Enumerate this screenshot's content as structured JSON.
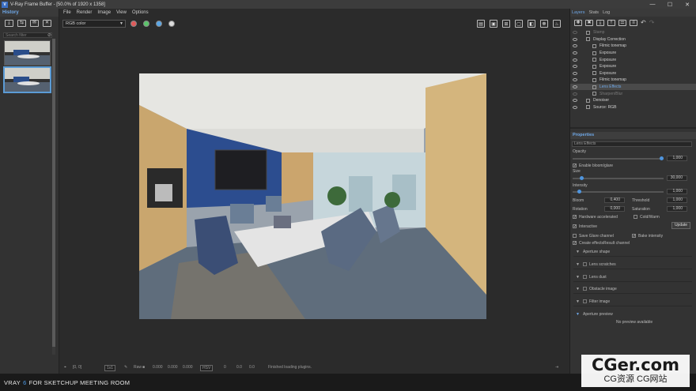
{
  "window": {
    "title": "V-Ray Frame Buffer - [50.0% of 1920 x 1358]",
    "app_icon": "V"
  },
  "history": {
    "title": "History",
    "search_placeholder": "Search filter",
    "thumbnails": [
      {
        "selected": false
      },
      {
        "selected": true
      }
    ]
  },
  "menu": [
    "File",
    "Render",
    "Image",
    "View",
    "Options"
  ],
  "toolbar": {
    "channel": "RGB color",
    "dots": [
      {
        "name": "red-channel-icon",
        "color": "#e05a5a"
      },
      {
        "name": "green-channel-icon",
        "color": "#5bc46a"
      },
      {
        "name": "blue-channel-icon",
        "color": "#5aa6e6"
      },
      {
        "name": "alpha-channel-icon",
        "color": "#dddddd"
      }
    ]
  },
  "status": {
    "coords": "[0, 0]",
    "zoom": "1x1",
    "mode": "Raw",
    "r": "0.000",
    "g": "0.000",
    "b": "0.000",
    "color_space": "HSV",
    "h": "0",
    "s": "0.0",
    "v": "0.0",
    "message": "Finished loading plugins."
  },
  "banner": {
    "part1": "VRAY",
    "part2": "6",
    "part3": "FOR SKETCHUP MEETING ROOM"
  },
  "right_panel": {
    "tabs": [
      "Layers",
      "Stats",
      "Log"
    ],
    "layers": [
      {
        "label": "Stamp",
        "indent": 0,
        "dim": true,
        "selected": false
      },
      {
        "label": "Display Correction",
        "indent": 0,
        "dim": false,
        "selected": false
      },
      {
        "label": "Filmic tonemap",
        "indent": 1,
        "dim": false,
        "selected": false
      },
      {
        "label": "Exposure",
        "indent": 1,
        "dim": false,
        "selected": false
      },
      {
        "label": "Exposure",
        "indent": 1,
        "dim": false,
        "selected": false
      },
      {
        "label": "Exposure",
        "indent": 1,
        "dim": false,
        "selected": false
      },
      {
        "label": "Exposure",
        "indent": 1,
        "dim": false,
        "selected": false
      },
      {
        "label": "Filmic tonemap",
        "indent": 1,
        "dim": false,
        "selected": false
      },
      {
        "label": "Lens Effects",
        "indent": 1,
        "dim": false,
        "selected": true
      },
      {
        "label": "Sharpen/Blur",
        "indent": 1,
        "dim": true,
        "selected": false
      },
      {
        "label": "Denoiser",
        "indent": 0,
        "dim": false,
        "selected": false
      },
      {
        "label": "Source: RGB",
        "indent": 0,
        "dim": false,
        "selected": false
      }
    ],
    "properties": {
      "title": "Properties",
      "layer_name": "Lens Effects",
      "opacity_label": "Opacity",
      "opacity": "1,000",
      "opacity_fraction": 1.0,
      "enable_bloom": "Enable bloom/glare",
      "size_label": "Size",
      "size": "30,000",
      "size_fraction": 0.08,
      "intensity_label": "Intensity",
      "intensity": "1,000",
      "intensity_fraction": 0.05,
      "bloom_label": "Bloom",
      "bloom": "0,400",
      "threshold_label": "Threshold",
      "threshold": "1,000",
      "rotation_label": "Rotation",
      "rotation": "0,000",
      "saturation_label": "Saturation",
      "saturation": "1,000",
      "hw_label": "Hardware accelerated",
      "cold_warm_label": "Cold/Warm",
      "interactive_label": "Interactive",
      "update_label": "Update",
      "save_glare_label": "Save Glare channel",
      "bake_intensity_label": "Bake intensity",
      "create_effects_label": "Create effectsResult channel",
      "sections": [
        "Aperture shape",
        "Lens scratches",
        "Lens dust",
        "Obstacle image",
        "Filter image",
        "Aperture preview"
      ],
      "preview_text": "No preview available"
    }
  },
  "watermark": {
    "line1": "CGer.com",
    "line2": "CG资源 CG网站"
  }
}
